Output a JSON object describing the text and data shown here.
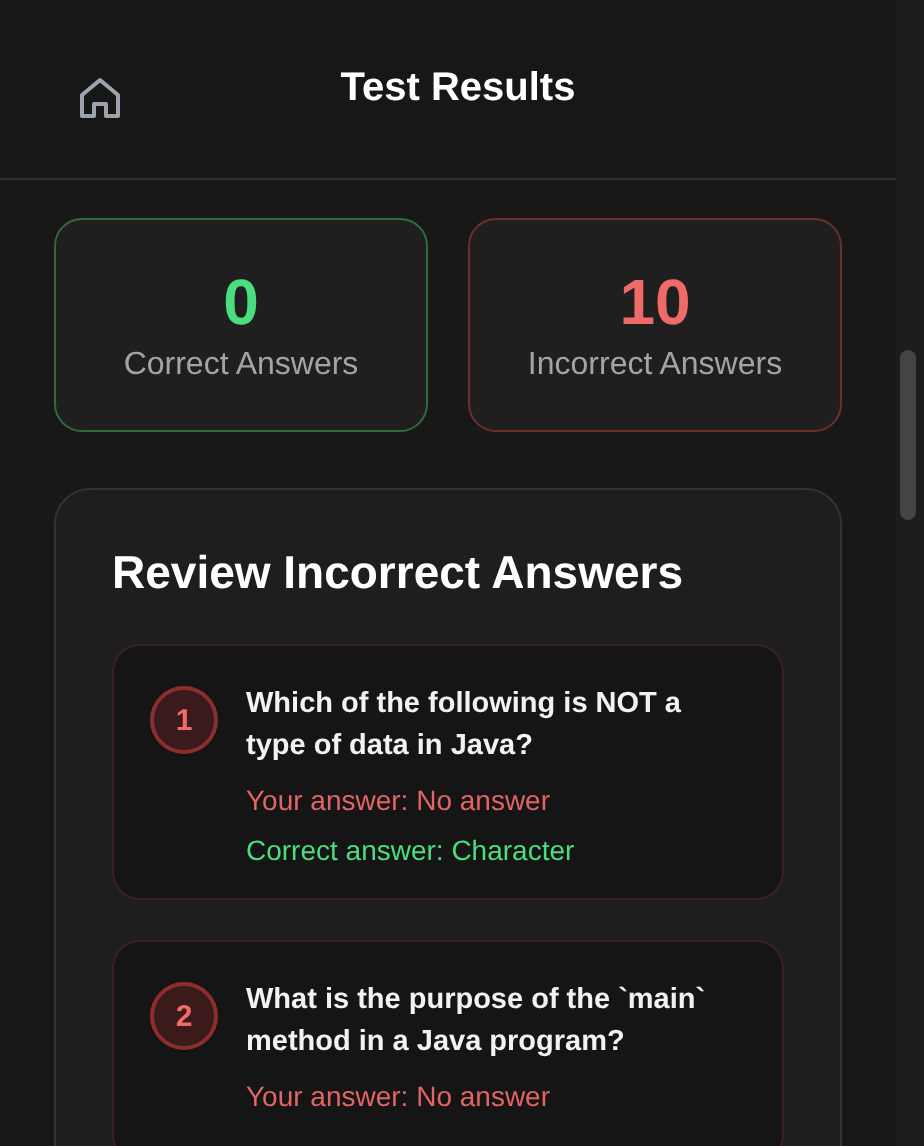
{
  "header": {
    "title": "Test Results"
  },
  "stats": [
    {
      "kind": "correct",
      "value": "0",
      "label": "Correct Answers"
    },
    {
      "kind": "incorrect",
      "value": "10",
      "label": "Incorrect Answers"
    }
  ],
  "review": {
    "title": "Review Incorrect Answers",
    "items": [
      {
        "number": "1",
        "question": "Which of the following is NOT a type of data in Java?",
        "your_answer": "Your answer: No answer",
        "correct_answer": "Correct answer: Character"
      },
      {
        "number": "2",
        "question": "What is the purpose of the `main` method in a Java program?",
        "your_answer": "Your answer: No answer"
      }
    ]
  }
}
